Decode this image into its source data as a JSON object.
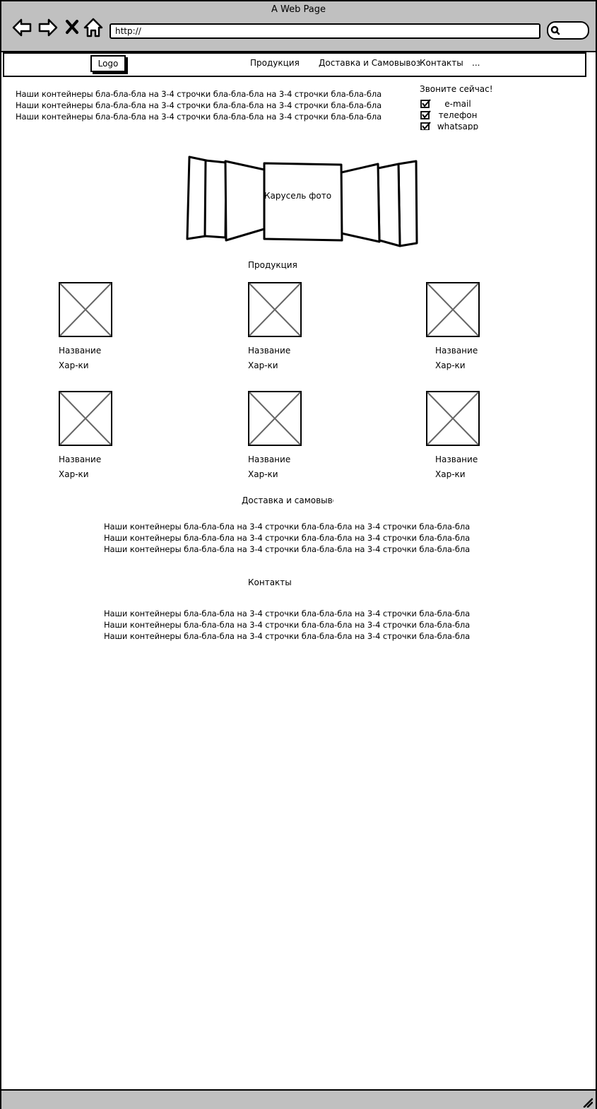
{
  "window": {
    "title": "A Web Page",
    "url": "http://"
  },
  "toolbar": {
    "back_icon": "arrow-left-icon",
    "forward_icon": "arrow-right-icon",
    "stop_icon": "close-icon",
    "home_icon": "home-icon",
    "search_icon": "search-icon"
  },
  "nav": {
    "logo": "Logo",
    "links": [
      "Продукция",
      "Доставка и Самовывоз",
      "Контакты",
      "..."
    ]
  },
  "intro": {
    "lines": [
      "Наши контейнеры бла-бла-бла на 3-4 строчки бла-бла-бла на 3-4 строчки бла-бла-бла",
      "Наши контейнеры бла-бла-бла на 3-4 строчки бла-бла-бла на 3-4 строчки бла-бла-бла",
      "Наши контейнеры бла-бла-бла на 3-4 строчки бла-бла-бла на 3-4 строчки бла-бла-бла"
    ]
  },
  "call": {
    "title": "Звоните сейчас!",
    "options": [
      {
        "label": "e-mail",
        "checked": true
      },
      {
        "label": "телефон",
        "checked": true
      },
      {
        "label": "whatsapp",
        "checked": true
      }
    ]
  },
  "carousel": {
    "label": "Карусель фото"
  },
  "products": {
    "heading": "Продукция",
    "items": [
      {
        "name": "Название",
        "specs": "Хар-ки",
        "image_icon": "image-placeholder-icon"
      },
      {
        "name": "Название",
        "specs": "Хар-ки",
        "image_icon": "image-placeholder-icon"
      },
      {
        "name": "Название",
        "specs": "Хар-ки",
        "image_icon": "image-placeholder-icon"
      },
      {
        "name": "Название",
        "specs": "Хар-ки",
        "image_icon": "image-placeholder-icon"
      },
      {
        "name": "Название",
        "specs": "Хар-ки",
        "image_icon": "image-placeholder-icon"
      },
      {
        "name": "Название",
        "specs": "Хар-ки",
        "image_icon": "image-placeholder-icon"
      }
    ]
  },
  "delivery": {
    "heading": "Доставка и самовывоз",
    "lines": [
      "Наши контейнеры бла-бла-бла на 3-4 строчки бла-бла-бла на 3-4 строчки бла-бла-бла",
      "Наши контейнеры бла-бла-бла на 3-4 строчки бла-бла-бла на 3-4 строчки бла-бла-бла",
      "Наши контейнеры бла-бла-бла на 3-4 строчки бла-бла-бла на 3-4 строчки бла-бла-бла"
    ]
  },
  "contacts": {
    "heading": "Контакты",
    "lines": [
      "Наши контейнеры бла-бла-бла на 3-4 строчки бла-бла-бла на 3-4 строчки бла-бла-бла",
      "Наши контейнеры бла-бла-бла на 3-4 строчки бла-бла-бла на 3-4 строчки бла-бла-бла",
      "Наши контейнеры бла-бла-бла на 3-4 строчки бла-бла-бла на 3-4 строчки бла-бла-бла"
    ]
  }
}
